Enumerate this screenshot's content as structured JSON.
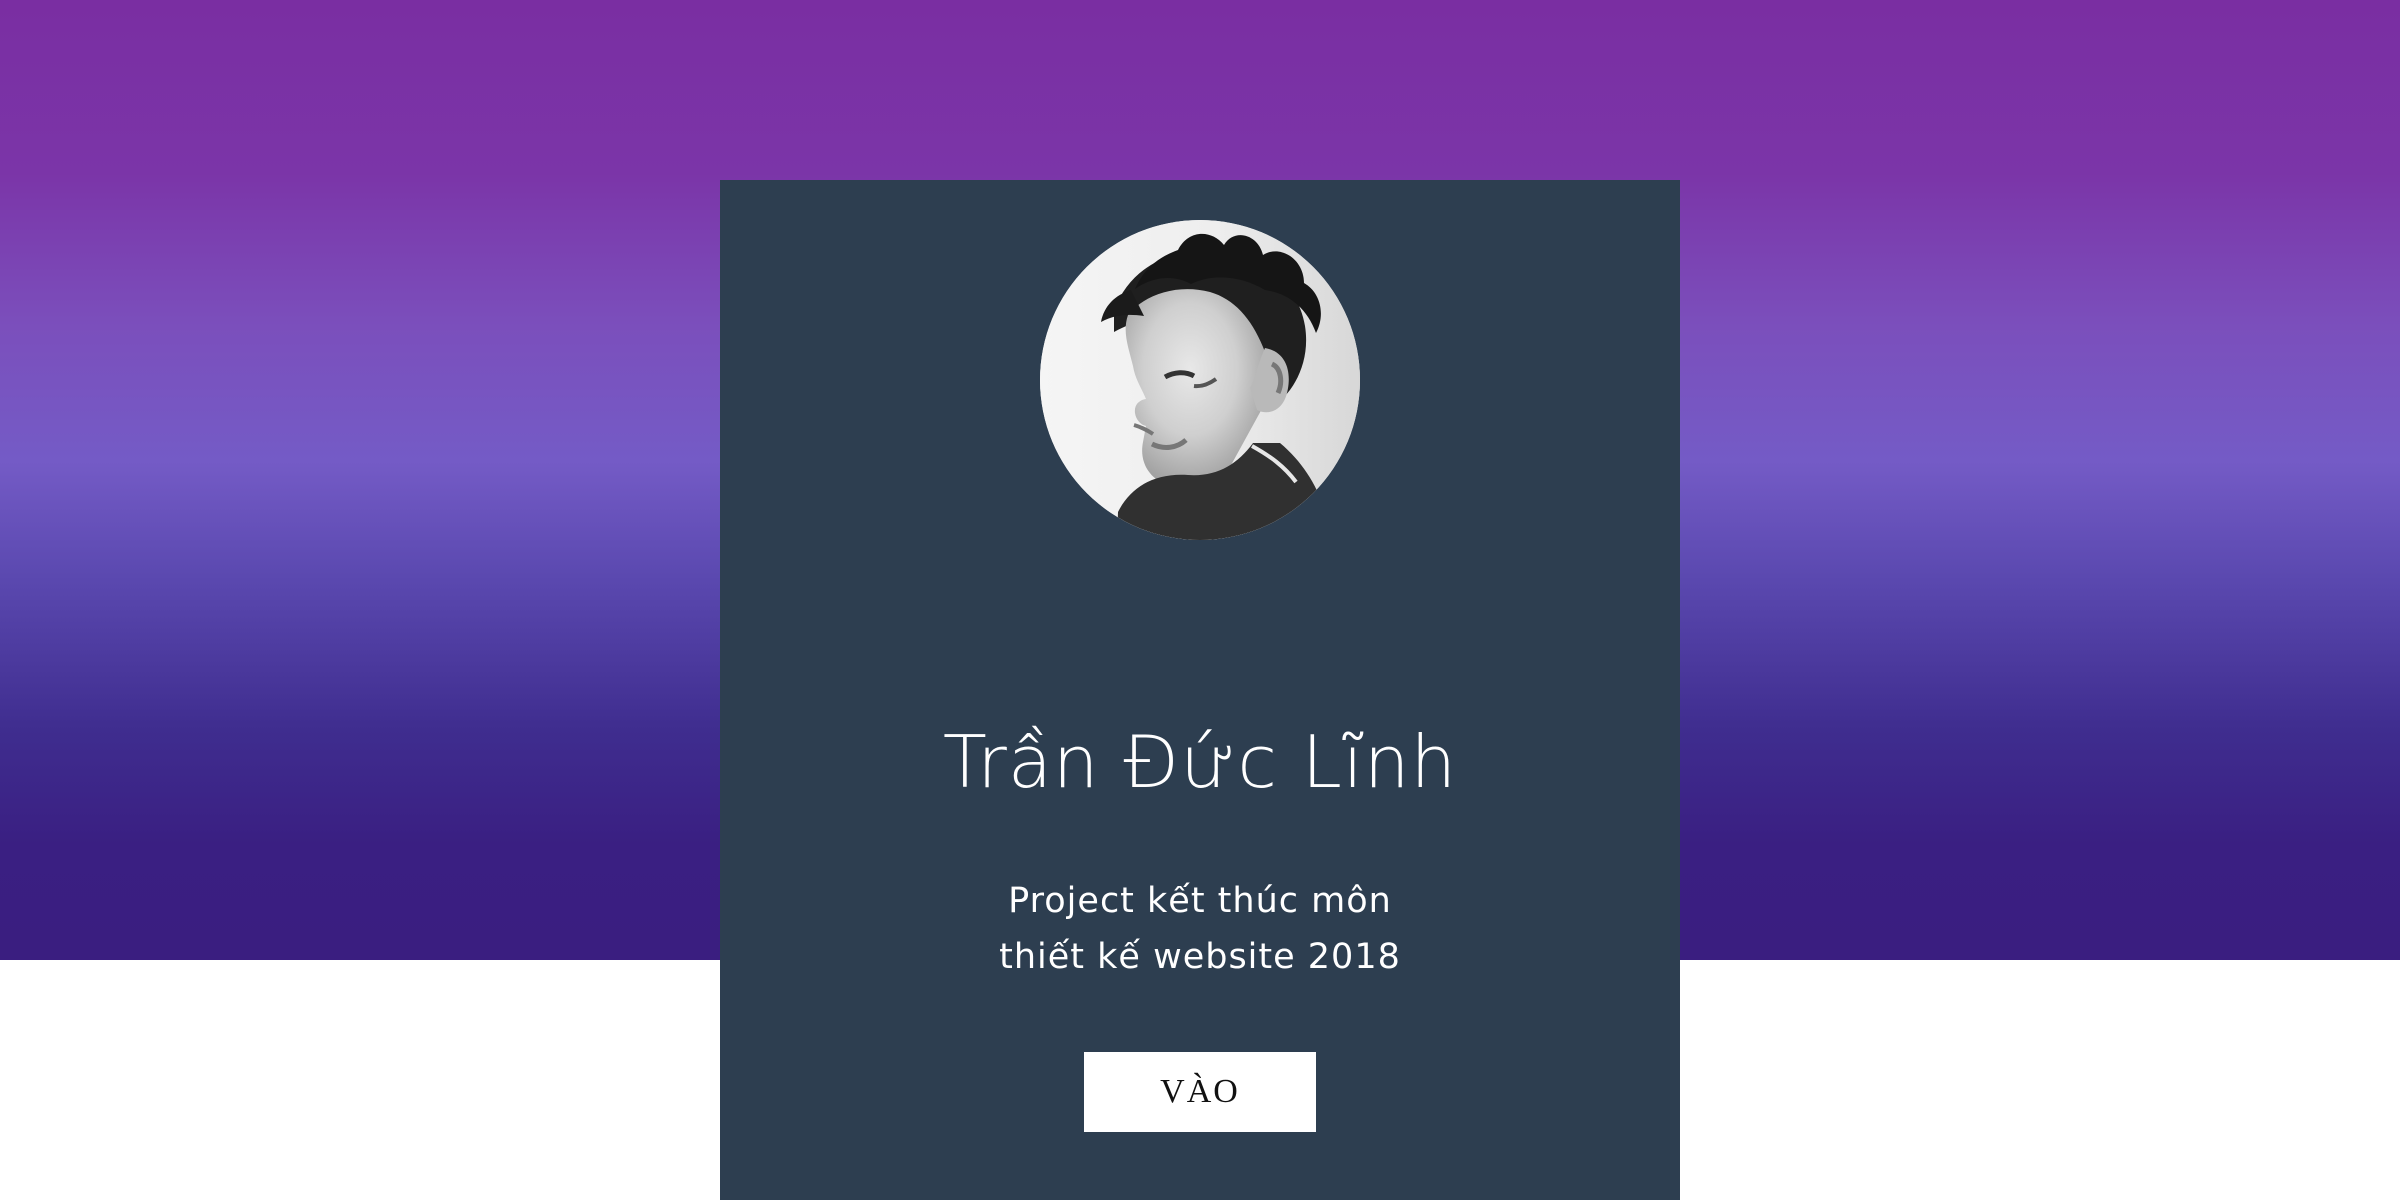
{
  "hero": {
    "colors": {
      "top": "#7a2ea2",
      "middle": "#745bc6",
      "bottom": "#3a1e80",
      "card": "#2d3e50"
    }
  },
  "profile": {
    "name": "Trần Đức Lĩnh",
    "subtitle_line_1": "Project kết thúc môn",
    "subtitle_line_2": "thiết kế website 2018",
    "avatar_icon": "person-profile-photo"
  },
  "actions": {
    "enter_label": "VÀO"
  }
}
